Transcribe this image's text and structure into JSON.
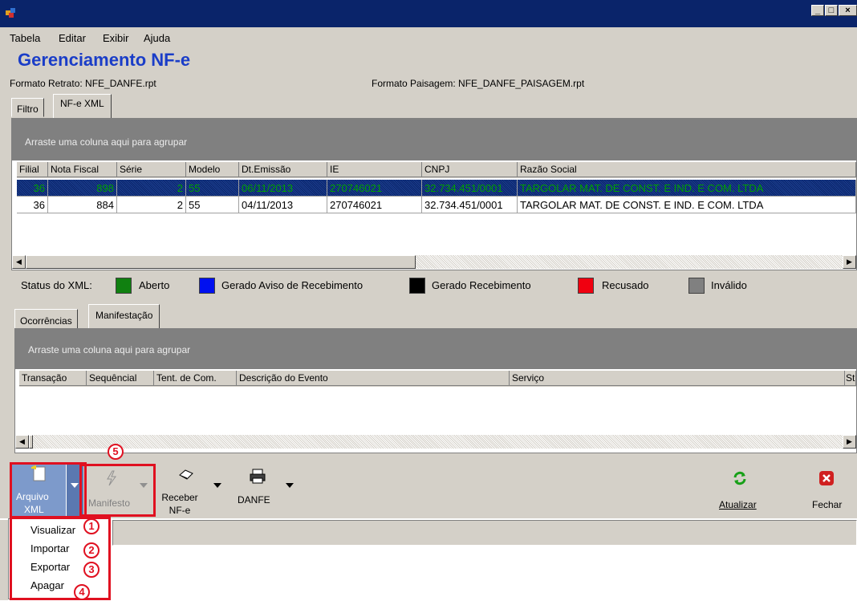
{
  "menu": [
    "Tabela",
    "Editar",
    "Exibir",
    "Ajuda"
  ],
  "page_title": "Gerenciamento NF-e",
  "format_retrato": "Formato Retrato: NFE_DANFE.rpt",
  "format_paisagem": "Formato Paisagem: NFE_DANFE_PAISAGEM.rpt",
  "top_tabs": [
    "Filtro",
    "NF-e XML"
  ],
  "group_hint": "Arraste uma coluna aqui para agrupar",
  "grid": {
    "columns": [
      "Filial",
      "Nota Fiscal",
      "Série",
      "Modelo",
      "Dt.Emissão",
      "IE",
      "CNPJ",
      "Razão Social"
    ],
    "rows": [
      [
        "36",
        "898",
        "2",
        "55",
        "06/11/2013",
        "270746021",
        "32.734.451/0001",
        "TARGOLAR MAT. DE CONST. E IND. E COM. LTDA"
      ],
      [
        "36",
        "884",
        "2",
        "55",
        "04/11/2013",
        "270746021",
        "32.734.451/0001",
        "TARGOLAR MAT. DE CONST. E IND. E COM. LTDA"
      ]
    ]
  },
  "status_legend": {
    "label": "Status do XML:",
    "items": [
      {
        "label": "Aberto",
        "color": "#108010"
      },
      {
        "label": "Gerado Aviso de Recebimento",
        "color": "#0010f0"
      },
      {
        "label": "Gerado Recebimento",
        "color": "#000000"
      },
      {
        "label": "Recusado",
        "color": "#f00010"
      },
      {
        "label": "Inválido",
        "color": "#808080"
      }
    ]
  },
  "bottom_tabs": [
    "Ocorrências",
    "Manifestação"
  ],
  "events_grid": {
    "columns": [
      "Transação",
      "Sequêncial",
      "Tent. de Com.",
      "Descrição do Evento",
      "Serviço",
      "St"
    ]
  },
  "toolbar": {
    "arquivo_xml": [
      "Arquivo",
      "XML"
    ],
    "manifesto": "Manifesto",
    "receber": [
      "Receber",
      "NF-e"
    ],
    "danfe": "DANFE",
    "atualizar": "Atualizar",
    "fechar": "Fechar"
  },
  "dropdown": [
    "Visualizar",
    "Importar",
    "Exportar",
    "Apagar"
  ],
  "callouts": [
    "1",
    "2",
    "3",
    "4",
    "5"
  ]
}
